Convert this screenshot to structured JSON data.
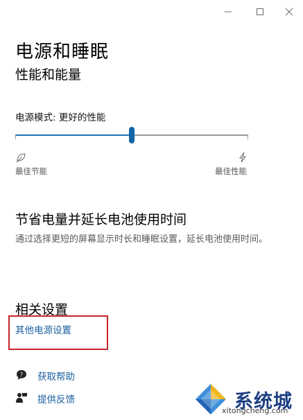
{
  "window": {
    "minimize_glyph": "—",
    "maximize_glyph": "☐",
    "close_glyph": "✕"
  },
  "page": {
    "title": "电源和睡眠",
    "subtitle": "性能和能量"
  },
  "power_mode": {
    "label": "电源模式: 更好的性能",
    "level": 0.5,
    "left_label": "最佳节能",
    "right_label": "最佳性能",
    "left_icon": "leaf-icon",
    "right_icon": "lightning-icon",
    "accent": "#1466a8"
  },
  "battery_section": {
    "heading": "节省电量并延长电池使用时间",
    "description": "通过选择更短的屏幕显示时长和睡眠设置，延长电池使用时间。"
  },
  "related": {
    "heading": "相关设置",
    "other_power_link": "其他电源设置",
    "highlight_color": "#c6242a"
  },
  "help": {
    "get_help": "获取帮助",
    "feedback": "提供反馈",
    "get_help_icon": "chat-help-icon",
    "feedback_icon": "feedback-person-icon"
  },
  "watermark": {
    "text": "系统城",
    "url": "xitongcheng.com"
  }
}
